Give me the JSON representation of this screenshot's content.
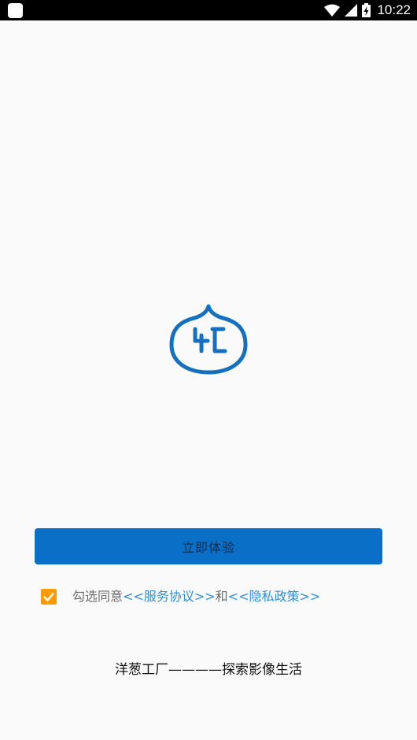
{
  "status_bar": {
    "time": "10:22",
    "icons": [
      "notification-square-icon",
      "wifi-icon",
      "cellular-signal-icon",
      "battery-charging-icon"
    ]
  },
  "logo": {
    "icon": "onion-logo-icon",
    "color": "#1570c0"
  },
  "primary_button": {
    "label": "立即体验",
    "background": "#0a6fc6"
  },
  "agreement": {
    "checked": true,
    "checkbox_color": "#ff9b00",
    "prefix": "勾选同意",
    "service_link": "<<服务协议>>",
    "and": "和",
    "privacy_link": "<<隐私政策>>",
    "link_color": "#2d8fd6"
  },
  "slogan": "洋葱工厂————探索影像生活"
}
